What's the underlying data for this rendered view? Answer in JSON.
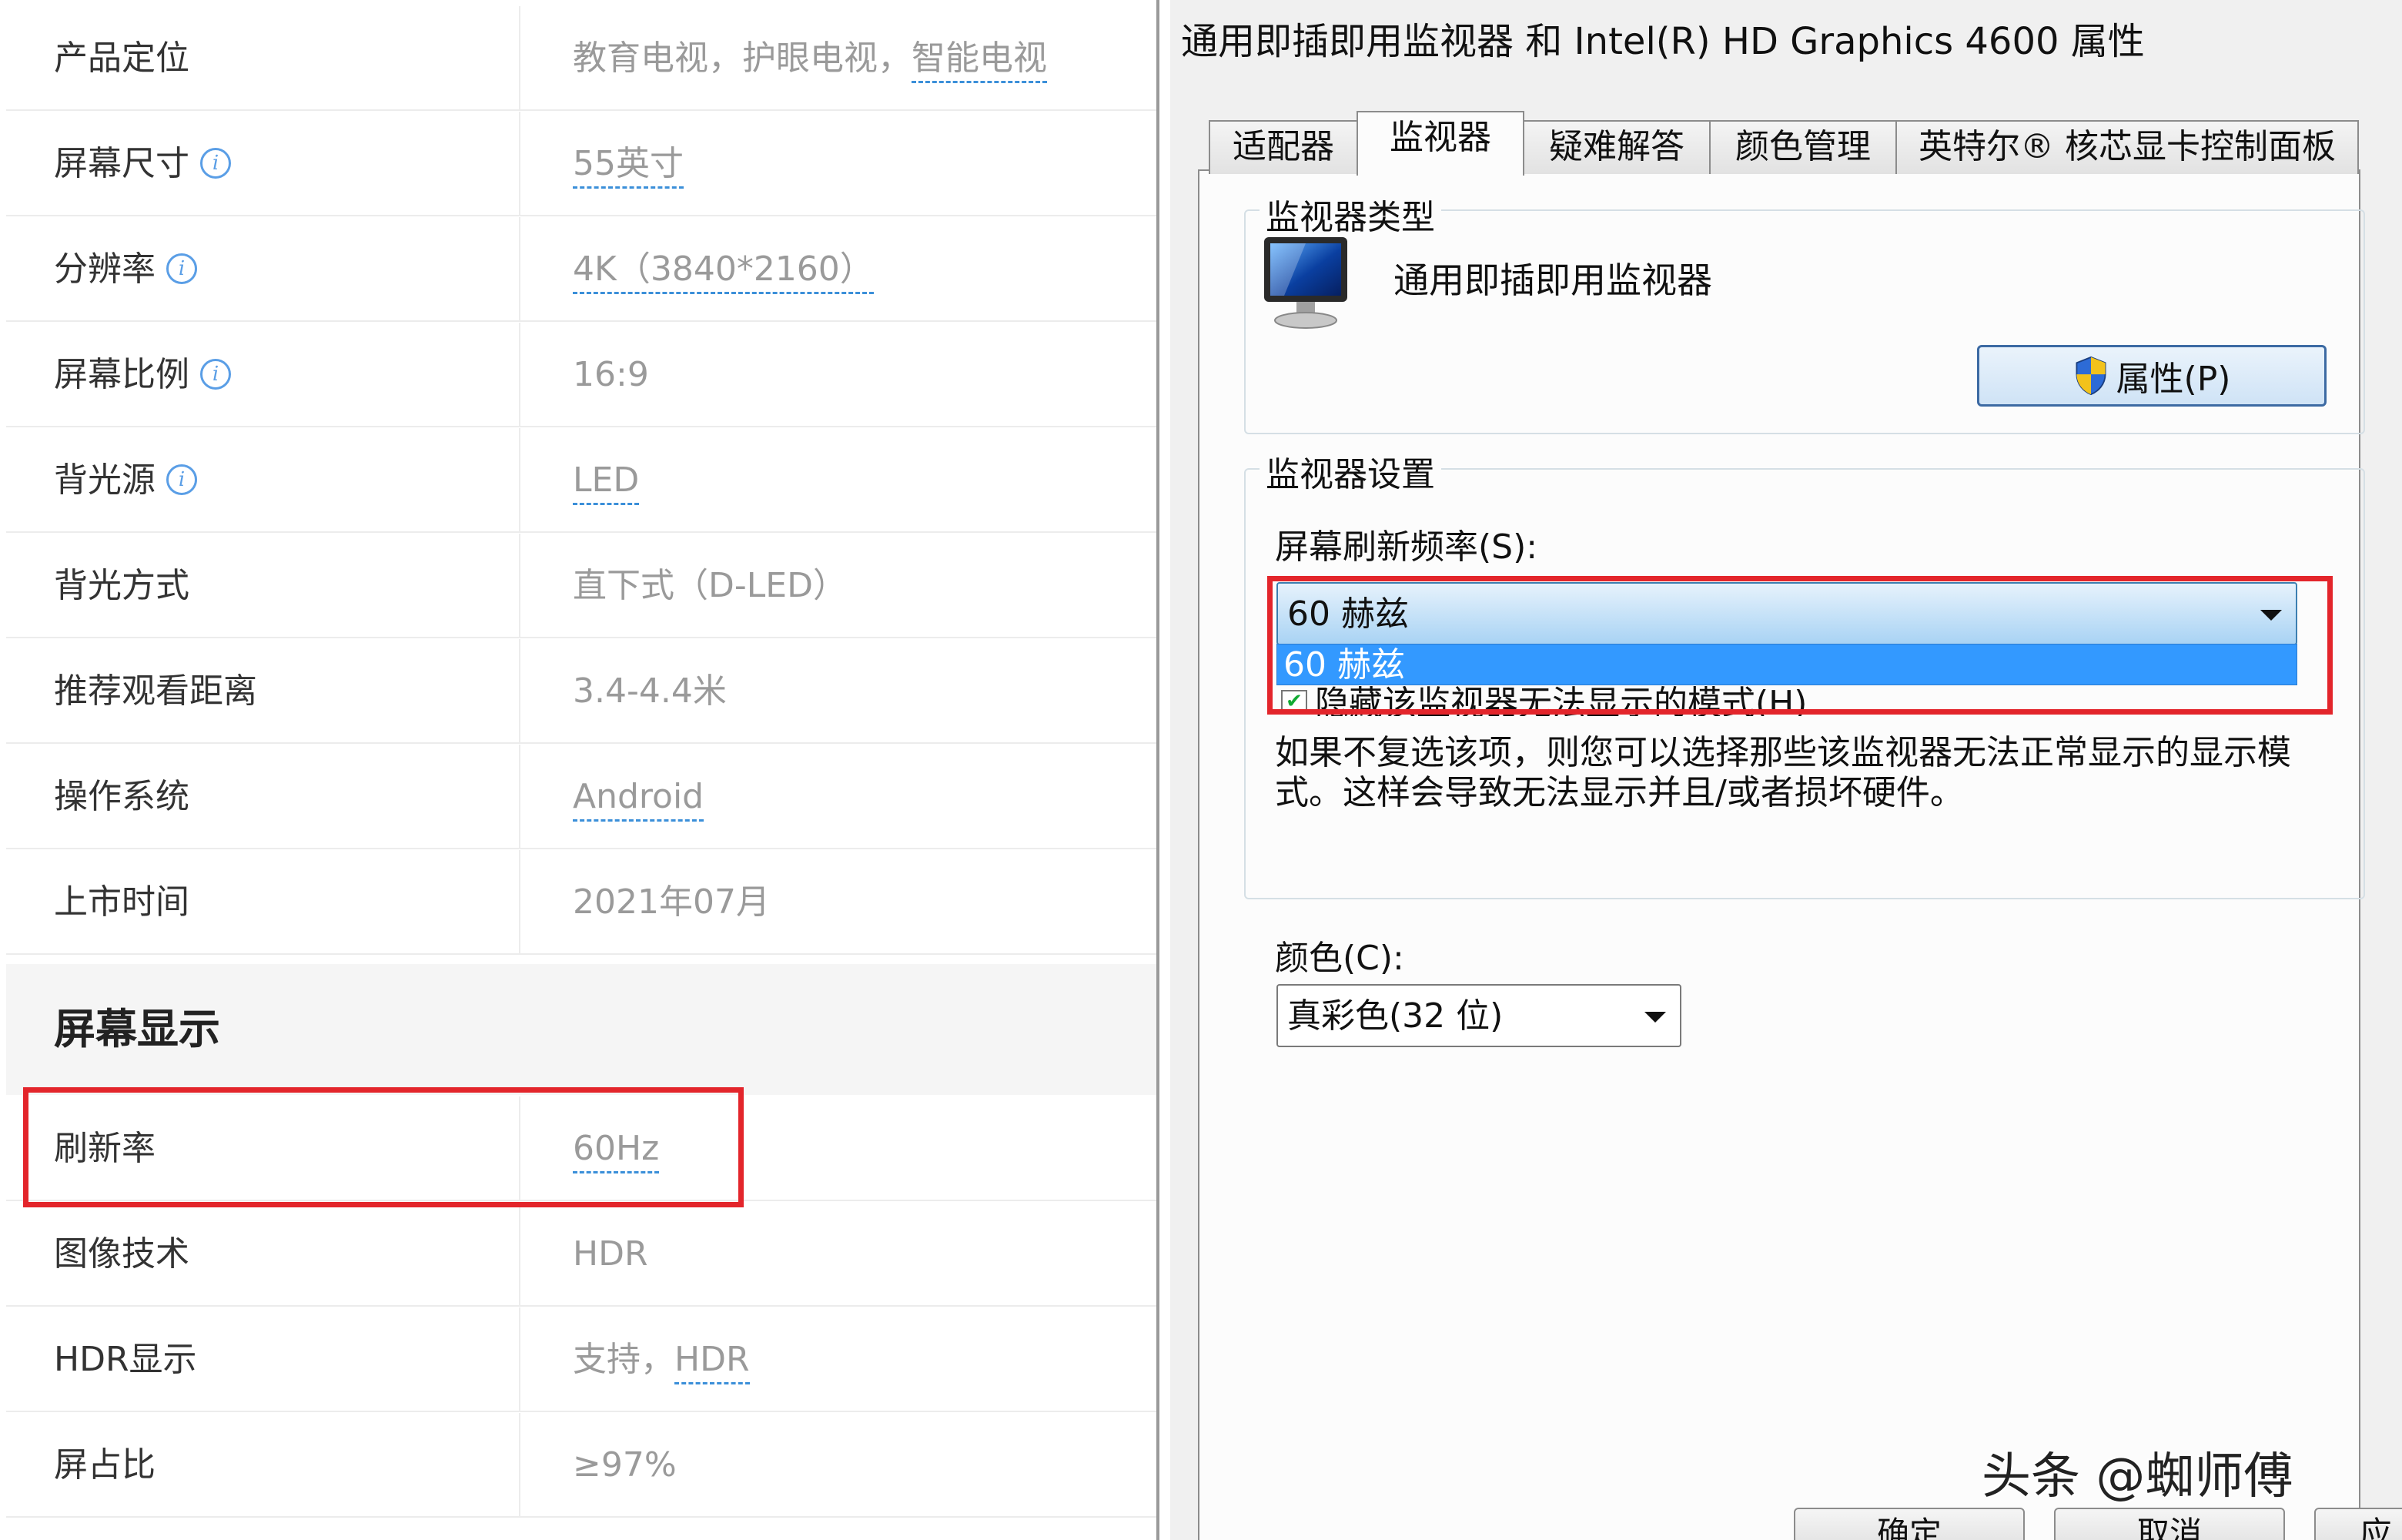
{
  "spec_table": {
    "rows": [
      {
        "label": "产品定位",
        "value": "教育电视，护眼电视，",
        "link": "智能电视",
        "info": false
      },
      {
        "label": "屏幕尺寸",
        "value": "",
        "link": "55英寸",
        "info": true
      },
      {
        "label": "分辨率",
        "value": "",
        "link": "4K（3840*2160）",
        "info": true
      },
      {
        "label": "屏幕比例",
        "value": "16:9",
        "link": "",
        "info": true
      },
      {
        "label": "背光源",
        "value": "",
        "link": "LED",
        "info": true
      },
      {
        "label": "背光方式",
        "value": "直下式（D-LED）",
        "link": "",
        "info": false
      },
      {
        "label": "推荐观看距离",
        "value": "3.4-4.4米",
        "link": "",
        "info": false
      },
      {
        "label": "操作系统",
        "value": "",
        "link": "Android",
        "info": false
      },
      {
        "label": "上市时间",
        "value": "2021年07月",
        "link": "",
        "info": false
      }
    ],
    "section_title": "屏幕显示",
    "section_rows": [
      {
        "label": "刷新率",
        "value": "",
        "link": "60Hz",
        "info": false
      },
      {
        "label": "图像技术",
        "value": "HDR",
        "link": "",
        "info": false
      },
      {
        "label": "HDR显示",
        "value": "支持，",
        "link": "HDR",
        "info": false
      },
      {
        "label": "屏占比",
        "value": "≥97%",
        "link": "",
        "info": false
      }
    ],
    "info_glyph": "i",
    "link_color": "#3b8fd9",
    "highlight_color": "#e3252b"
  },
  "dialog": {
    "title": "通用即插即用监视器 和 Intel(R) HD Graphics 4600 属性",
    "tabs": [
      "适配器",
      "监视器",
      "疑难解答",
      "颜色管理",
      "英特尔® 核芯显卡控制面板"
    ],
    "active_tab": "监视器",
    "monitor_type": {
      "group_title": "监视器类型",
      "monitor_name": "通用即插即用监视器",
      "properties_button": "属性(P)",
      "icon": "monitor-icon"
    },
    "monitor_settings": {
      "group_title": "监视器设置",
      "refresh_label": "屏幕刷新频率(S):",
      "refresh_selected": "60 赫兹",
      "refresh_options": [
        "60 赫兹"
      ],
      "hide_modes_label": "隐藏该监视器无法显示的模式(H)",
      "hide_modes_checked": true,
      "explanation": "如果不复选该项，则您可以选择那些该监视器无法正常显示的显示模式。这样会导致无法显示并且/或者损坏硬件。"
    },
    "color": {
      "label": "颜色(C):",
      "selected": "真彩色(32 位)"
    },
    "bottom_buttons": [
      "确定",
      "取消",
      "应"
    ],
    "highlight_color": "#e3252b",
    "selection_color": "#3399ff"
  },
  "watermark": "头条 @蜘师傅"
}
